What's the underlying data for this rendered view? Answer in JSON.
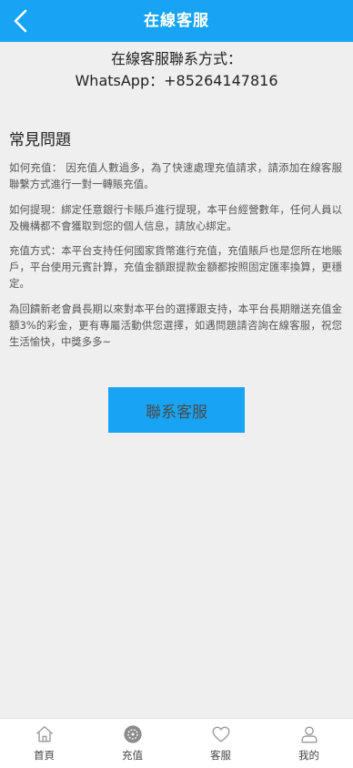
{
  "header": {
    "title": "在線客服"
  },
  "contact": {
    "heading": "在線客服聯系方式：",
    "whatsapp_line": "WhatsApp：+85264147816"
  },
  "faq": {
    "title": "常見問題",
    "items": [
      {
        "text": "如何充值：  因充值人數過多，為了快速處理充值請求，請添加在線客服聯繫方式進行一對一轉賬充值。"
      },
      {
        "text": "如何提現：綁定任意銀行卡賬戶進行提現，本平台經營數年，任何人員以及機構都不會獲取到您的個人信息，請放心綁定。"
      },
      {
        "text": "充值方式：本平台支持任何國家貨幣進行充值，充值賬戶也是您所在地賬戶，平台使用元賓計算，充值金額跟提款金額都按照固定匯率換算，更穩定。"
      },
      {
        "text": "為回饋新老會員長期以來對本平台的選擇跟支持，本平台長期贈送充值金額3%的彩金，更有專屬活動供您選擇，如遇問題請咨詢在線客服，祝您生活愉快，中獎多多~"
      }
    ]
  },
  "contact_button": {
    "label": "聯系客服"
  },
  "tabbar": {
    "tabs": [
      {
        "label": "首頁",
        "icon": "home-icon"
      },
      {
        "label": "充值",
        "icon": "recharge-icon"
      },
      {
        "label": "客服",
        "icon": "heart-icon"
      },
      {
        "label": "我的",
        "icon": "user-icon"
      }
    ]
  },
  "colors": {
    "accent": "#18a4f4",
    "background": "#efefef"
  }
}
